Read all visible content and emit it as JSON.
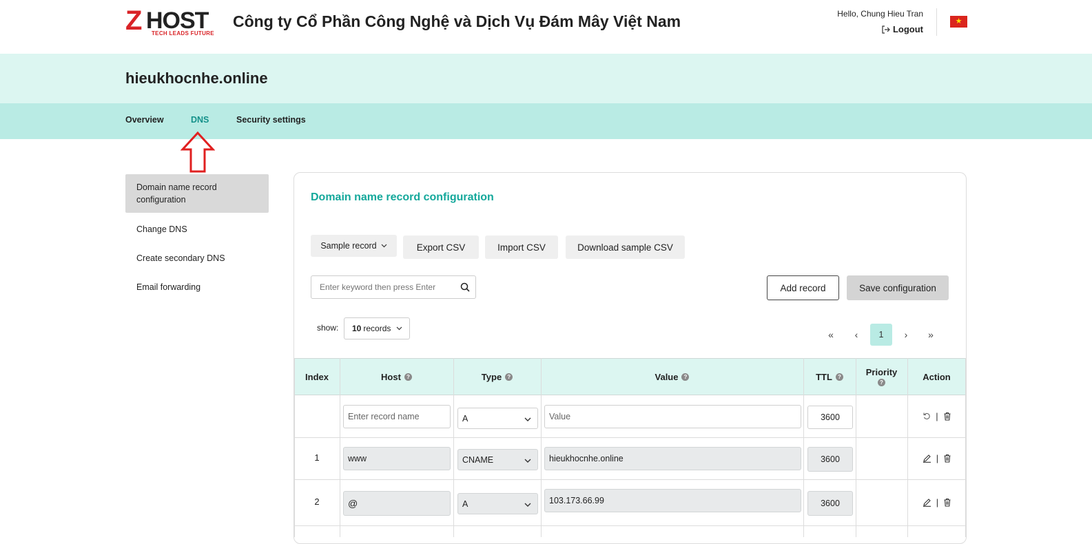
{
  "header": {
    "logo_z": "Z",
    "logo_host": "HOST",
    "logo_tagline": "TECH LEADS FUTURE",
    "company": "Công ty Cổ Phần Công Nghệ và Dịch Vụ Đám Mây Việt Nam",
    "hello": "Hello, Chung Hieu Tran",
    "logout": "Logout",
    "flag_star": "★"
  },
  "domain": "hieukhocnhe.online",
  "nav": {
    "overview": "Overview",
    "dns": "DNS",
    "security": "Security settings",
    "active": "DNS"
  },
  "sidebar": [
    {
      "label": "Domain name record configuration",
      "active": true
    },
    {
      "label": "Change DNS",
      "active": false
    },
    {
      "label": "Create secondary DNS",
      "active": false
    },
    {
      "label": "Email forwarding",
      "active": false
    }
  ],
  "card": {
    "title": "Domain name record configuration",
    "sample_record": "Sample record",
    "export_csv": "Export CSV",
    "import_csv": "Import CSV",
    "download_sample": "Download sample CSV",
    "search_placeholder": "Enter keyword then press Enter",
    "add_record": "Add record",
    "save_config": "Save configuration",
    "show_label": "show:",
    "show_count": "10",
    "show_unit": "records",
    "pagination": {
      "first": "«",
      "prev": "‹",
      "current": "1",
      "next": "›",
      "last": "»"
    }
  },
  "table": {
    "headers": {
      "index": "Index",
      "host": "Host",
      "type": "Type",
      "value": "Value",
      "ttl": "TTL",
      "priority": "Priority",
      "action": "Action"
    },
    "help_glyph": "?",
    "new_row": {
      "host_placeholder": "Enter record name",
      "type": "A",
      "value_placeholder": "Value",
      "ttl": "3600"
    },
    "rows": [
      {
        "index": "1",
        "host": "www",
        "type": "CNAME",
        "value": "hieukhocnhe.online",
        "ttl": "3600"
      },
      {
        "index": "2",
        "host": "@",
        "type": "A",
        "value": "103.173.66.99",
        "ttl": "3600"
      }
    ],
    "action_separator": "|"
  },
  "colors": {
    "brand_red": "#d92327",
    "accent_teal": "#14a89b",
    "band_light": "#dcf6f1",
    "band_dark": "#b9ebe4",
    "annotation_red": "#e02020"
  }
}
